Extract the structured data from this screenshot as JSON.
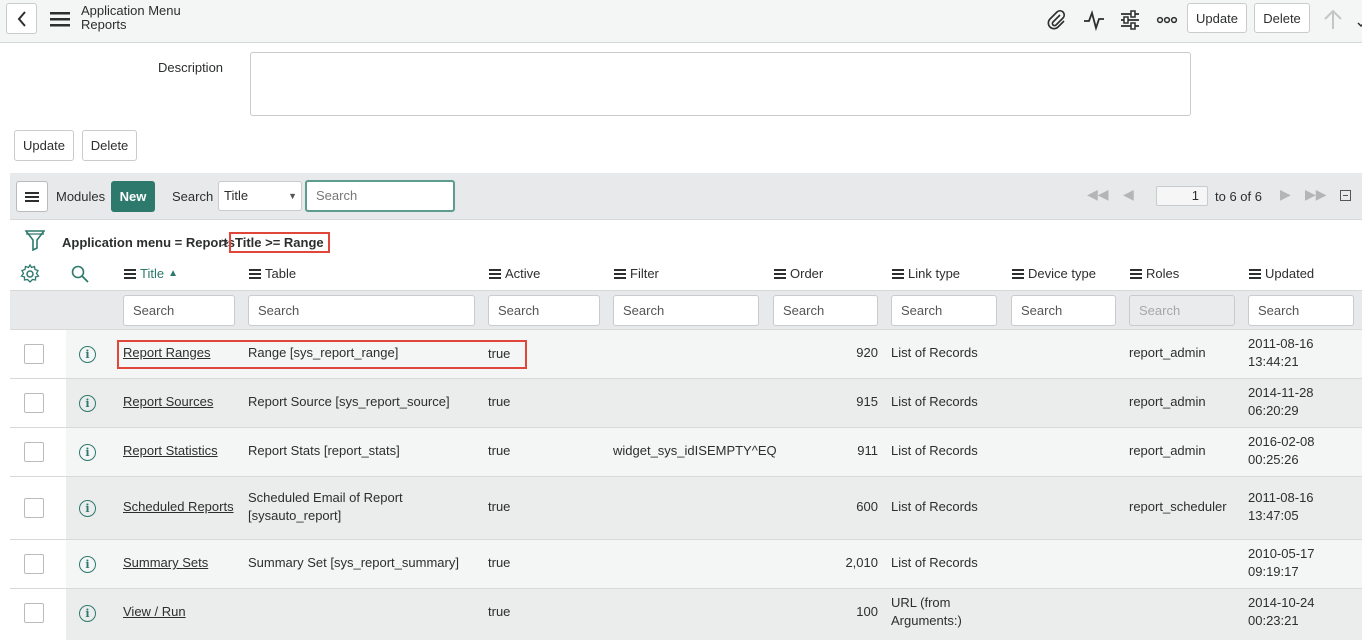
{
  "header": {
    "title_line1": "Application Menu",
    "title_line2": "Reports",
    "update_label": "Update",
    "delete_label": "Delete"
  },
  "form": {
    "description_label": "Description",
    "description_value": "",
    "update_label": "Update",
    "delete_label": "Delete"
  },
  "list": {
    "name": "Modules",
    "new_label": "New",
    "search_label": "Search",
    "search_field": "Title",
    "search_placeholder": "Search",
    "page_current": "1",
    "page_range": "to 6 of 6"
  },
  "breadcrumb": {
    "first": "Application menu = Reports",
    "separator": ">",
    "second": "Title >= Range"
  },
  "columns": [
    "Title",
    "Table",
    "Active",
    "Filter",
    "Order",
    "Link type",
    "Device type",
    "Roles",
    "Updated"
  ],
  "column_search_placeholder": "Search",
  "rows": [
    {
      "title": "Report Ranges",
      "table_l1": "Range [sys_report_range]",
      "table_l2": "",
      "active": "true",
      "filter": "",
      "order": "920",
      "link_l1": "List of Records",
      "link_l2": "",
      "device": "",
      "roles": "report_admin",
      "upd_date": "2011-08-16",
      "upd_time": "13:44:21"
    },
    {
      "title": "Report Sources",
      "table_l1": "Report Source [sys_report_source]",
      "table_l2": "",
      "active": "true",
      "filter": "",
      "order": "915",
      "link_l1": "List of Records",
      "link_l2": "",
      "device": "",
      "roles": "report_admin",
      "upd_date": "2014-11-28",
      "upd_time": "06:20:29"
    },
    {
      "title": "Report Statistics",
      "table_l1": "Report Stats [report_stats]",
      "table_l2": "",
      "active": "true",
      "filter": "widget_sys_idISEMPTY^EQ",
      "order": "911",
      "link_l1": "List of Records",
      "link_l2": "",
      "device": "",
      "roles": "report_admin",
      "upd_date": "2016-02-08",
      "upd_time": "00:25:26"
    },
    {
      "title": "Scheduled Reports",
      "table_l1": "Scheduled Email of Report",
      "table_l2": "[sysauto_report]",
      "active": "true",
      "filter": "",
      "order": "600",
      "link_l1": "List of Records",
      "link_l2": "",
      "device": "",
      "roles": "report_scheduler",
      "upd_date": "2011-08-16",
      "upd_time": "13:47:05"
    },
    {
      "title": "Summary Sets",
      "table_l1": "Summary Set [sys_report_summary]",
      "table_l2": "",
      "active": "true",
      "filter": "",
      "order": "2,010",
      "link_l1": "List of Records",
      "link_l2": "",
      "device": "",
      "roles": "",
      "upd_date": "2010-05-17",
      "upd_time": "09:19:17"
    },
    {
      "title": "View / Run",
      "table_l1": "",
      "table_l2": "",
      "active": "true",
      "filter": "",
      "order": "100",
      "link_l1": "URL (from",
      "link_l2": "Arguments:)",
      "device": "",
      "roles": "",
      "upd_date": "2014-10-24",
      "upd_time": "00:23:21"
    }
  ]
}
